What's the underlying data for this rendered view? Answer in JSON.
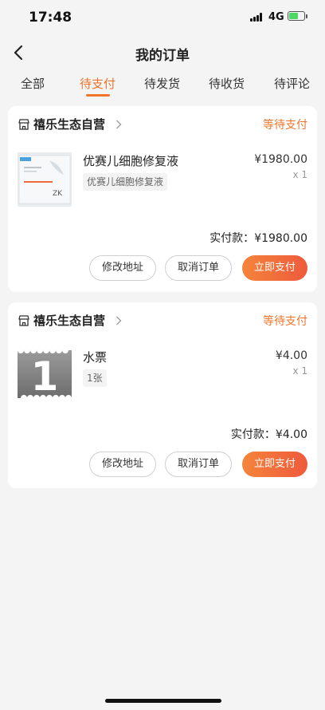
{
  "status_bar": {
    "time": "17:48",
    "network": "4G",
    "battery_color": "#4cd964"
  },
  "header": {
    "title": "我的订单",
    "back_icon": "chevron-left-icon"
  },
  "tabs": [
    {
      "label": "全部",
      "active": false
    },
    {
      "label": "待支付",
      "active": true
    },
    {
      "label": "待发货",
      "active": false
    },
    {
      "label": "待收货",
      "active": false
    },
    {
      "label": "待评论",
      "active": false
    }
  ],
  "accent_color": "#f0742a",
  "orders": [
    {
      "shop_name": "禧乐生态自营",
      "status": "等待支付",
      "product_name": "优赛儿细胞修复液",
      "product_spec": "优赛儿细胞修复液",
      "price": "¥1980.00",
      "quantity": "x 1",
      "total_label": "实付款：",
      "total_value": "¥1980.00",
      "buttons": {
        "modify_address": "修改地址",
        "cancel_order": "取消订单",
        "pay_now": "立即支付"
      }
    },
    {
      "shop_name": "禧乐生态自营",
      "status": "等待支付",
      "product_name": "水票",
      "product_spec": "1张",
      "image_text": "1",
      "price": "¥4.00",
      "quantity": "x 1",
      "total_label": "实付款：",
      "total_value": "¥4.00",
      "buttons": {
        "modify_address": "修改地址",
        "cancel_order": "取消订单",
        "pay_now": "立即支付"
      }
    }
  ]
}
